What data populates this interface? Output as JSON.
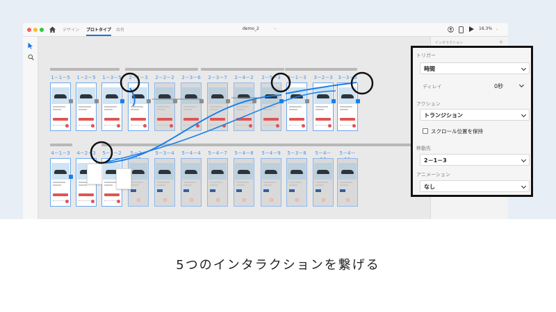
{
  "titlebar": {
    "tabs": [
      "デザイン",
      "プロトタイプ",
      "共有"
    ],
    "active_tab": "プロトタイプ",
    "document_title": "demo_2",
    "document_caret": "⌄",
    "zoom": "16.3%",
    "zoom_caret": "⌄"
  },
  "toolbar": {
    "tools": [
      "select-tool",
      "zoom-tool"
    ]
  },
  "canvas": {
    "row1_labels": [
      "1－1－5",
      "1－2－5",
      "1－3－5",
      "2－1－3",
      "2－2－2",
      "2－3－6",
      "2－3－7",
      "2－4－2",
      "2－5－3",
      "3－1－3",
      "3－2－3",
      "3－3－3"
    ],
    "row2_labels": [
      "4－1－3",
      "4－2－3",
      "5－1－2",
      "5－2－12",
      "5－3－4",
      "5－4－4",
      "5－4－7",
      "5－4－8",
      "5－4－9",
      "5－3－8",
      "5－4－10",
      "5－4－11"
    ]
  },
  "right_panel": {
    "header": "インタラクション",
    "add_glyph": "＋"
  },
  "interaction_panel": {
    "trigger_label": "トリガー",
    "trigger_value": "時間",
    "delay_label": "ディレイ",
    "delay_value": "0秒",
    "action_label": "アクション",
    "action_value": "トランジション",
    "preserve_scroll_label": "スクロール位置を保持",
    "preserve_scroll_checked": false,
    "destination_label": "移動先",
    "destination_value": "2－1－3",
    "animation_label": "アニメーション",
    "animation_value": "なし"
  },
  "caption": "5つのインタラクションを繋げる",
  "colors": {
    "wire": "#1a7fe8",
    "accent": "#1473e6",
    "panel_border": "#111111",
    "background": "#e8eef6"
  }
}
